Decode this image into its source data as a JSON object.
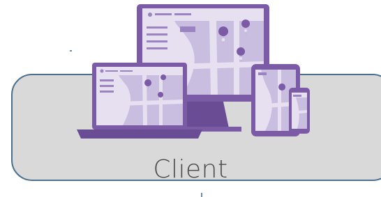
{
  "diagram": {
    "label": "Client",
    "icons": [
      "desktop-monitor-icon",
      "laptop-icon",
      "tablet-icon",
      "phone-icon",
      "map-pin-icon"
    ],
    "colors": {
      "box_fill": "#d9d9d9",
      "box_border": "#4a6f8f",
      "device_dark": "#7b5aa6",
      "device_mid": "#9b82c0",
      "device_light": "#c9bde0",
      "device_pale": "#e6e0f1",
      "label_text": "#4a4a4a"
    }
  }
}
